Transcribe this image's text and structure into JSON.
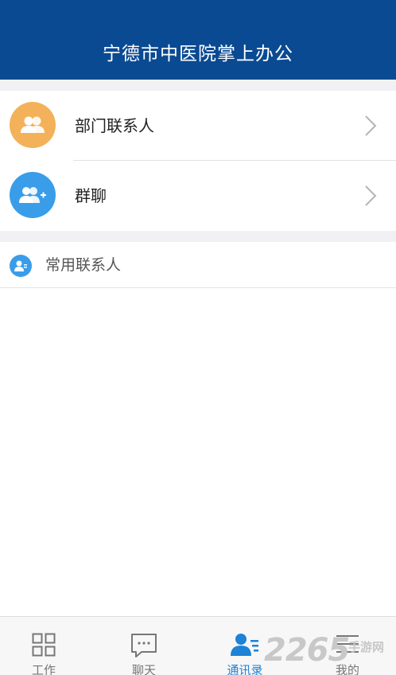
{
  "header": {
    "title": "宁德市中医院掌上办公"
  },
  "contacts": {
    "rows": [
      {
        "label": "部门联系人",
        "icon": "group-icon",
        "color": "#f3b15a"
      },
      {
        "label": "群聊",
        "icon": "add-group-icon",
        "color": "#3a9de9"
      }
    ],
    "frequent": {
      "label": "常用联系人",
      "icon": "contact-icon"
    }
  },
  "tabbar": {
    "tabs": [
      {
        "label": "工作",
        "icon": "grid-icon",
        "active": false
      },
      {
        "label": "聊天",
        "icon": "chat-icon",
        "active": false
      },
      {
        "label": "通讯录",
        "icon": "contacts-icon",
        "active": true
      },
      {
        "label": "我的",
        "icon": "menu-icon",
        "active": false
      }
    ]
  },
  "watermark": {
    "number": "2265",
    "text": "手游网"
  },
  "colors": {
    "header": "#0a4a93",
    "accent": "#1e82d6",
    "orange": "#f3b15a",
    "blue": "#3a9de9"
  }
}
